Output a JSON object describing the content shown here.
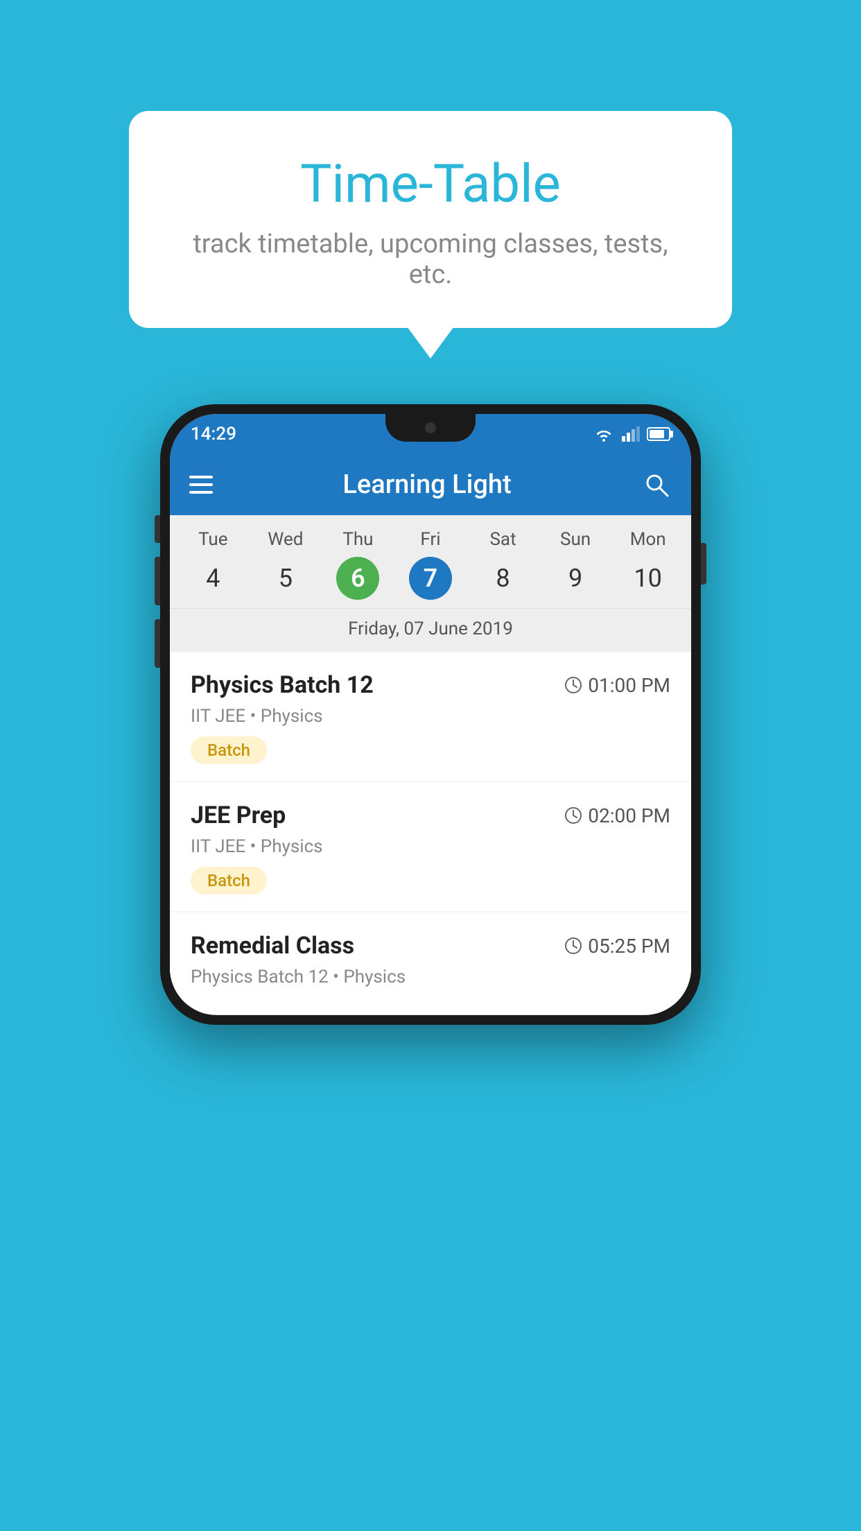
{
  "background_color": "#29b6d8",
  "speech_bubble": {
    "title": "Time-Table",
    "subtitle": "track timetable, upcoming classes, tests, etc."
  },
  "phone": {
    "status_bar": {
      "time": "14:29"
    },
    "app_bar": {
      "title": "Learning Light"
    },
    "calendar": {
      "days": [
        {
          "name": "Tue",
          "num": "4",
          "state": "normal"
        },
        {
          "name": "Wed",
          "num": "5",
          "state": "normal"
        },
        {
          "name": "Thu",
          "num": "6",
          "state": "today"
        },
        {
          "name": "Fri",
          "num": "7",
          "state": "selected"
        },
        {
          "name": "Sat",
          "num": "8",
          "state": "normal"
        },
        {
          "name": "Sun",
          "num": "9",
          "state": "normal"
        },
        {
          "name": "Mon",
          "num": "10",
          "state": "normal"
        }
      ],
      "selected_date_label": "Friday, 07 June 2019"
    },
    "classes": [
      {
        "name": "Physics Batch 12",
        "time": "01:00 PM",
        "detail": "IIT JEE • Physics",
        "tag": "Batch"
      },
      {
        "name": "JEE Prep",
        "time": "02:00 PM",
        "detail": "IIT JEE • Physics",
        "tag": "Batch"
      },
      {
        "name": "Remedial Class",
        "time": "05:25 PM",
        "detail": "Physics Batch 12 • Physics",
        "tag": null
      }
    ]
  }
}
